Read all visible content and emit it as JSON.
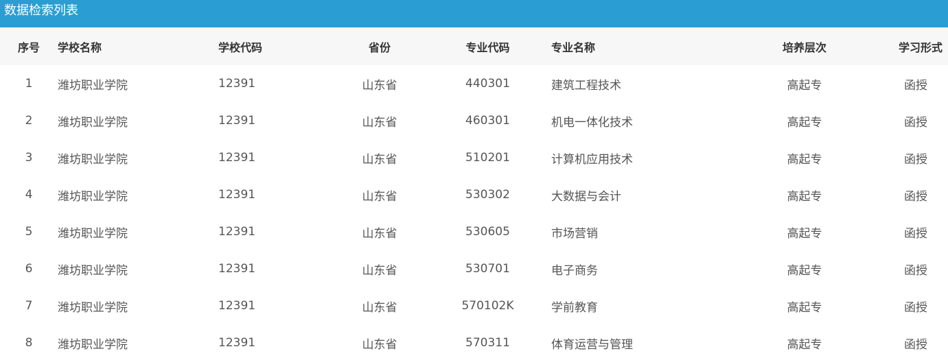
{
  "panel": {
    "title": "数据检索列表"
  },
  "table": {
    "columns": [
      "序号",
      "学校名称",
      "学校代码",
      "省份",
      "专业代码",
      "专业名称",
      "培养层次",
      "学习形式"
    ],
    "rows": [
      [
        "1",
        "潍坊职业学院",
        "12391",
        "山东省",
        "440301",
        "建筑工程技术",
        "高起专",
        "函授"
      ],
      [
        "2",
        "潍坊职业学院",
        "12391",
        "山东省",
        "460301",
        "机电一体化技术",
        "高起专",
        "函授"
      ],
      [
        "3",
        "潍坊职业学院",
        "12391",
        "山东省",
        "510201",
        "计算机应用技术",
        "高起专",
        "函授"
      ],
      [
        "4",
        "潍坊职业学院",
        "12391",
        "山东省",
        "530302",
        "大数据与会计",
        "高起专",
        "函授"
      ],
      [
        "5",
        "潍坊职业学院",
        "12391",
        "山东省",
        "530605",
        "市场营销",
        "高起专",
        "函授"
      ],
      [
        "6",
        "潍坊职业学院",
        "12391",
        "山东省",
        "530701",
        "电子商务",
        "高起专",
        "函授"
      ],
      [
        "7",
        "潍坊职业学院",
        "12391",
        "山东省",
        "570102K",
        "学前教育",
        "高起专",
        "函授"
      ],
      [
        "8",
        "潍坊职业学院",
        "12391",
        "山东省",
        "570311",
        "体育运营与管理",
        "高起专",
        "函授"
      ]
    ]
  },
  "colors": {
    "header_bar": "#2a9ed2",
    "header_text": "#ffffff",
    "table_head_bg": "#f7f7f7",
    "cell_text": "#555555"
  }
}
